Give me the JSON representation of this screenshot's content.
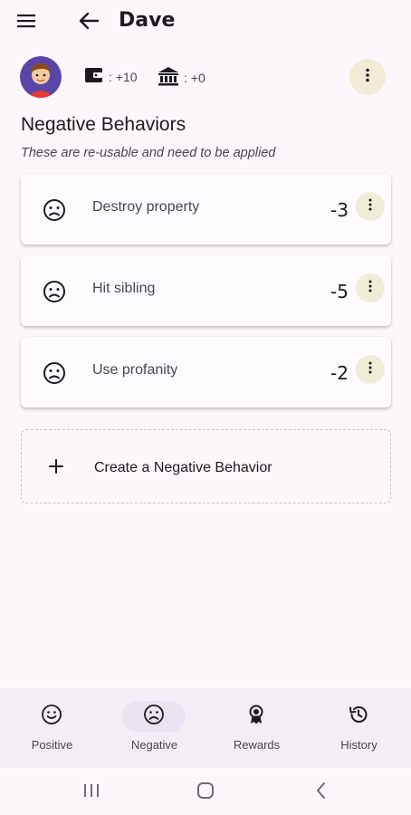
{
  "header": {
    "title": "Dave"
  },
  "stats": {
    "wallet_value": ": +10",
    "bank_value": ": +0"
  },
  "section": {
    "title": "Negative Behaviors",
    "subtitle": "These are re-usable and need to be applied"
  },
  "behaviors": [
    {
      "name": "Destroy property",
      "points": "-3"
    },
    {
      "name": "Hit sibling",
      "points": "-5"
    },
    {
      "name": "Use profanity",
      "points": "-2"
    }
  ],
  "create": {
    "label": "Create a Negative Behavior"
  },
  "nav": {
    "items": [
      {
        "label": "Positive"
      },
      {
        "label": "Negative"
      },
      {
        "label": "Rewards"
      },
      {
        "label": "History"
      }
    ],
    "active": "Negative"
  },
  "colors": {
    "accent_chip": "#f1ecd8",
    "active_pill": "#ebe2f2",
    "background": "#fdf7fb"
  }
}
